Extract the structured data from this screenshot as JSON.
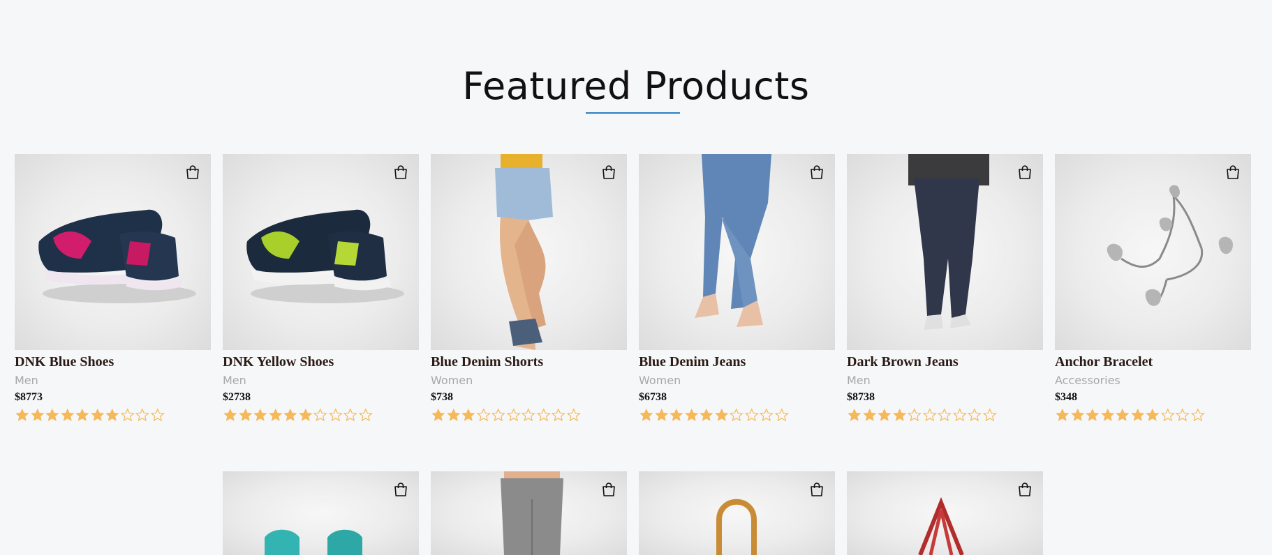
{
  "page": {
    "title": "Featured Products"
  },
  "colors": {
    "accent": "#2a7fc2",
    "star": "#f5b85a",
    "background": "#f6f7f9"
  },
  "products": [
    {
      "name": "DNK Blue Shoes",
      "category": "Men",
      "price": "$8773",
      "rating": 7,
      "max_rating": 10,
      "image": "shoes-blue"
    },
    {
      "name": "DNK Yellow Shoes",
      "category": "Men",
      "price": "$2738",
      "rating": 6,
      "max_rating": 10,
      "image": "shoes-yellow"
    },
    {
      "name": "Blue Denim Shorts",
      "category": "Women",
      "price": "$738",
      "rating": 3,
      "max_rating": 10,
      "image": "denim-shorts"
    },
    {
      "name": "Blue Denim Jeans",
      "category": "Women",
      "price": "$6738",
      "rating": 6,
      "max_rating": 10,
      "image": "denim-jeans"
    },
    {
      "name": "Dark Brown Jeans",
      "category": "Men",
      "price": "$8738",
      "rating": 4,
      "max_rating": 10,
      "image": "dark-jeans"
    },
    {
      "name": "Anchor Bracelet",
      "category": "Accessories",
      "price": "$348",
      "rating": 7,
      "max_rating": 10,
      "image": "bracelet"
    }
  ],
  "products_row2": [
    {
      "image": "teal-sandals"
    },
    {
      "image": "grey-jeans"
    },
    {
      "image": "tan-handbag"
    },
    {
      "image": "red-handbag"
    }
  ],
  "icons": {
    "cart": "shopping-bag-icon",
    "star_full": "star-filled-icon",
    "star_empty": "star-outline-icon"
  }
}
